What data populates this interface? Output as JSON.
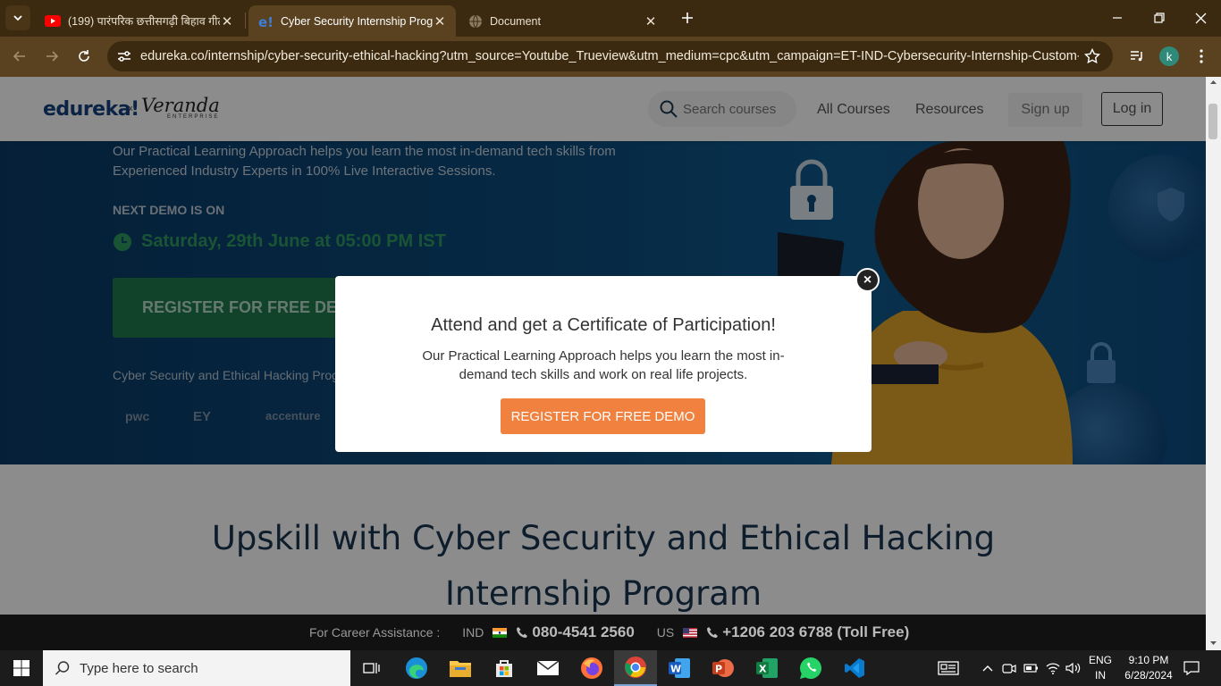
{
  "browser": {
    "tabs": [
      {
        "title": "(199) पारंपरिक छत्तीसगढ़ी बिहाव गीत",
        "favicon": "youtube-icon"
      },
      {
        "title": "Cyber Security Internship Progr",
        "favicon": "edureka-icon"
      },
      {
        "title": "Document",
        "favicon": "globe-icon"
      }
    ],
    "url": "edureka.co/internship/cyber-security-ethical-hacking?utm_source=Youtube_Trueview&utm_medium=cpc&utm_campaign=ET-IND-Cybersecurity-Internship-Custom-Int...",
    "profile_initial": "k"
  },
  "header": {
    "logo": "edureka!",
    "logo_x": "x",
    "partner_logo": "Veranda",
    "partner_sub": "ENTERPRISE",
    "search_placeholder": "Search courses",
    "nav": [
      "All Courses",
      "Resources"
    ],
    "signup": "Sign up",
    "login": "Log in"
  },
  "hero": {
    "description": "Our Practical Learning Approach helps you learn the most in-demand tech skills from Experienced Industry Experts in 100% Live Interactive Sessions.",
    "demo_label": "NEXT DEMO IS ON",
    "demo_date": "Saturday, 29th June at 05:00 PM IST",
    "cta": "REGISTER FOR FREE DEMO",
    "partners_title": "Cyber Security and Ethical Hacking Program",
    "partners": [
      "pwc",
      "EY",
      "accenture"
    ]
  },
  "section": {
    "title": "Upskill with Cyber Security and Ethical Hacking Internship Program"
  },
  "modal": {
    "title": "Attend and get a Certificate of Participation!",
    "text": "Our Practical Learning Approach helps you learn the most in-demand tech skills and work on real life projects.",
    "button": "REGISTER FOR FREE DEMO",
    "close": "×"
  },
  "career_bar": {
    "label": "For Career Assistance :",
    "ind_label": "IND",
    "ind_phone": "080-4541 2560",
    "us_label": "US",
    "us_phone": "+1206 203 6788 (Toll Free)"
  },
  "taskbar": {
    "search_placeholder": "Type here to search",
    "apps": [
      "task-view",
      "edge",
      "file-explorer",
      "microsoft-store",
      "mail",
      "firefox",
      "chrome",
      "word",
      "powerpoint",
      "excel",
      "whatsapp",
      "vscode"
    ],
    "lang_top": "ENG",
    "lang_bottom": "IN",
    "time": "9:10 PM",
    "date": "6/28/2024"
  },
  "colors": {
    "accent_orange": "#f0813e",
    "hero_blue": "#0b4a7b",
    "demo_green": "#2f9a62",
    "brand_blue": "#14417e"
  }
}
